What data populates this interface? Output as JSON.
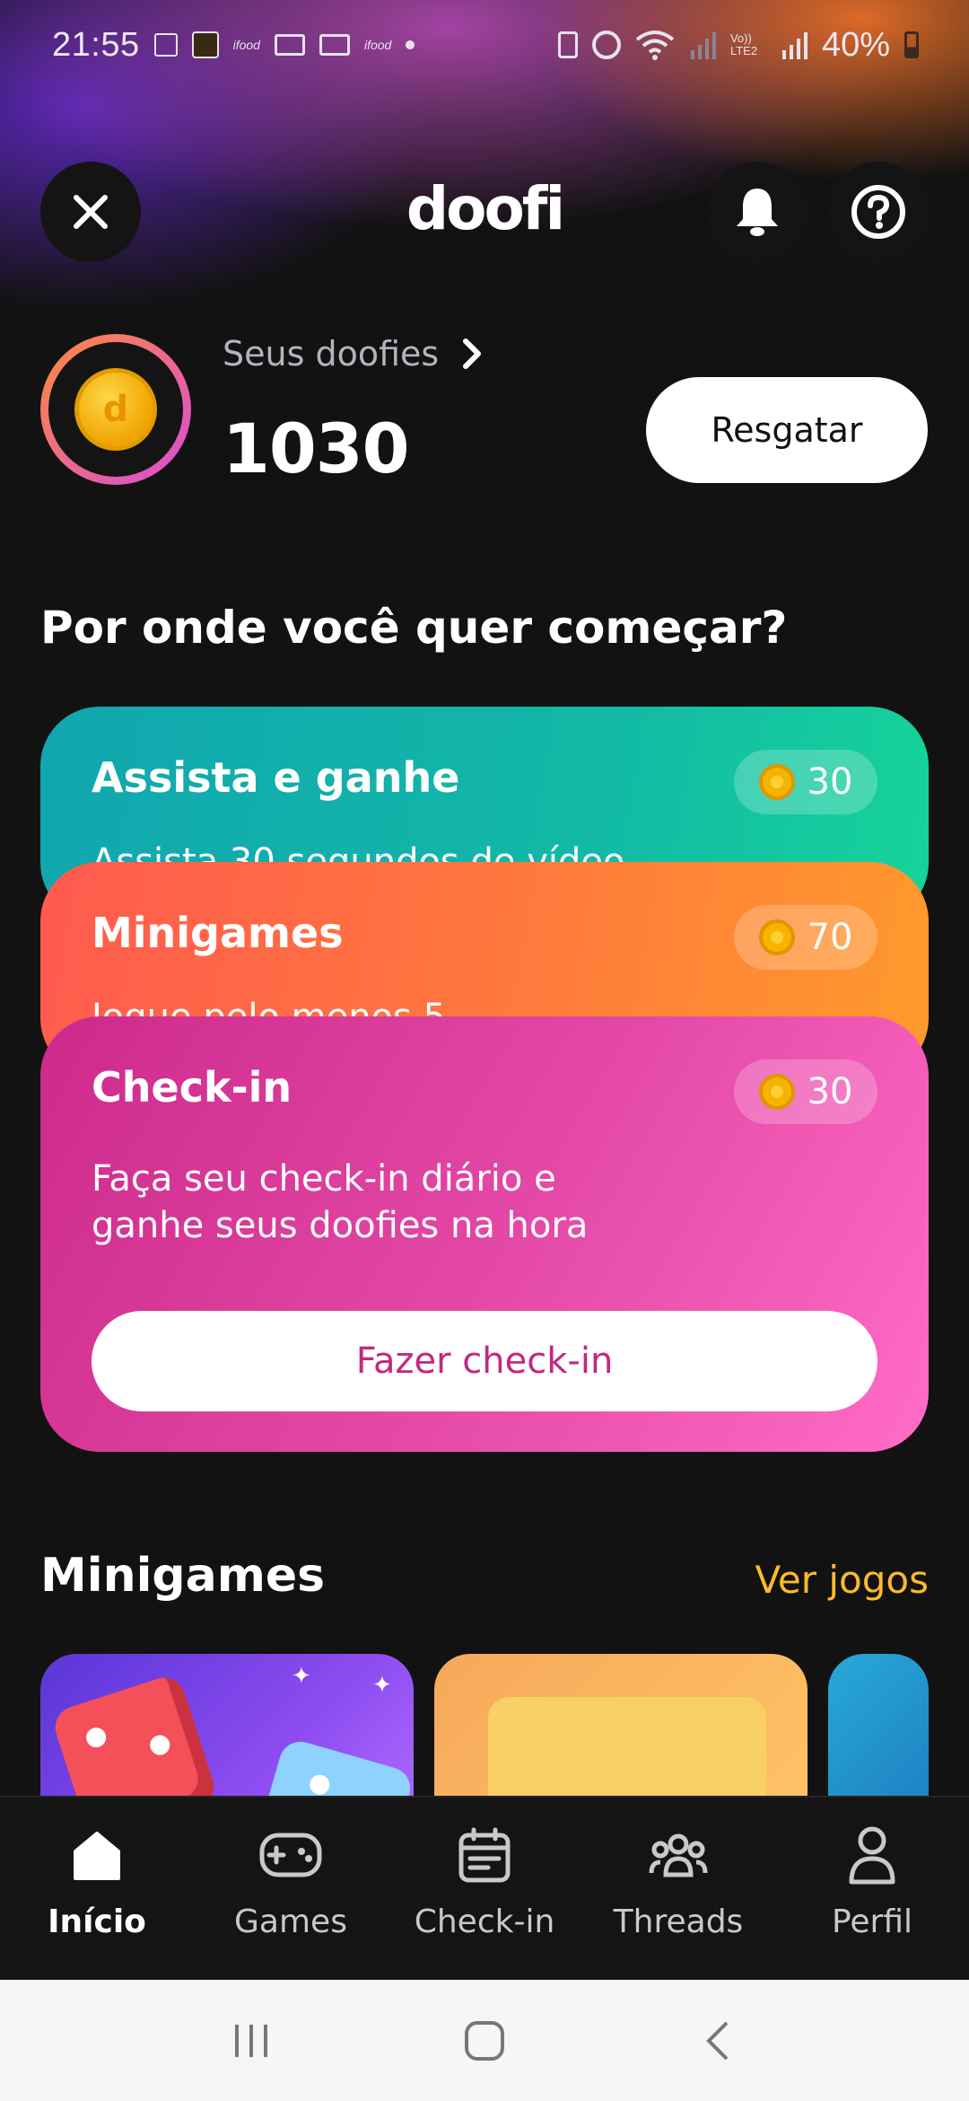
{
  "status_bar": {
    "time": "21:55",
    "battery": "40%",
    "icons": [
      "notification-app-icon",
      "ifood-icon",
      "mail-icon",
      "mail-icon",
      "ifood-icon",
      "dot-icon",
      "battery-saver-icon",
      "alarm-icon",
      "wifi-icon",
      "signal-icon",
      "volte-icon",
      "signal-icon",
      "battery-icon"
    ],
    "ifood_label": "ifood",
    "volte_label": "Vo)) LTE2"
  },
  "header": {
    "logo": "doofi",
    "close_icon": "close-icon",
    "bell_icon": "bell-icon",
    "help_icon": "help-icon"
  },
  "balance": {
    "label": "Seus doofies",
    "value": "1030",
    "redeem_label": "Resgatar"
  },
  "section_title": "Por onde você quer começar?",
  "cards": {
    "watch": {
      "title": "Assista e ganhe",
      "reward": "30",
      "desc_partial": "Assista 30 segundos de vídeo"
    },
    "minigames": {
      "title": "Minigames",
      "reward": "70",
      "desc_partial": "Jogue pelo menos 5"
    },
    "checkin": {
      "title": "Check-in",
      "reward": "30",
      "desc": "Faça seu check-in diário e ganhe seus doofies na hora",
      "button": "Fazer check-in"
    }
  },
  "minigames_section": {
    "title": "Minigames",
    "link": "Ver jogos"
  },
  "nav": [
    {
      "label": "Início",
      "icon": "home-icon",
      "active": true
    },
    {
      "label": "Games",
      "icon": "gamepad-icon",
      "active": false
    },
    {
      "label": "Check-in",
      "icon": "calendar-icon",
      "active": false
    },
    {
      "label": "Threads",
      "icon": "group-icon",
      "active": false
    },
    {
      "label": "Perfil",
      "icon": "user-icon",
      "active": false
    }
  ],
  "colors": {
    "background": "#121212",
    "accent_link": "#ffba2a",
    "teal_card": "#12b8a6",
    "orange_card": "#ff7a3c",
    "pink_card": "#e54aa8",
    "checkin_button_text": "#c4277f"
  }
}
